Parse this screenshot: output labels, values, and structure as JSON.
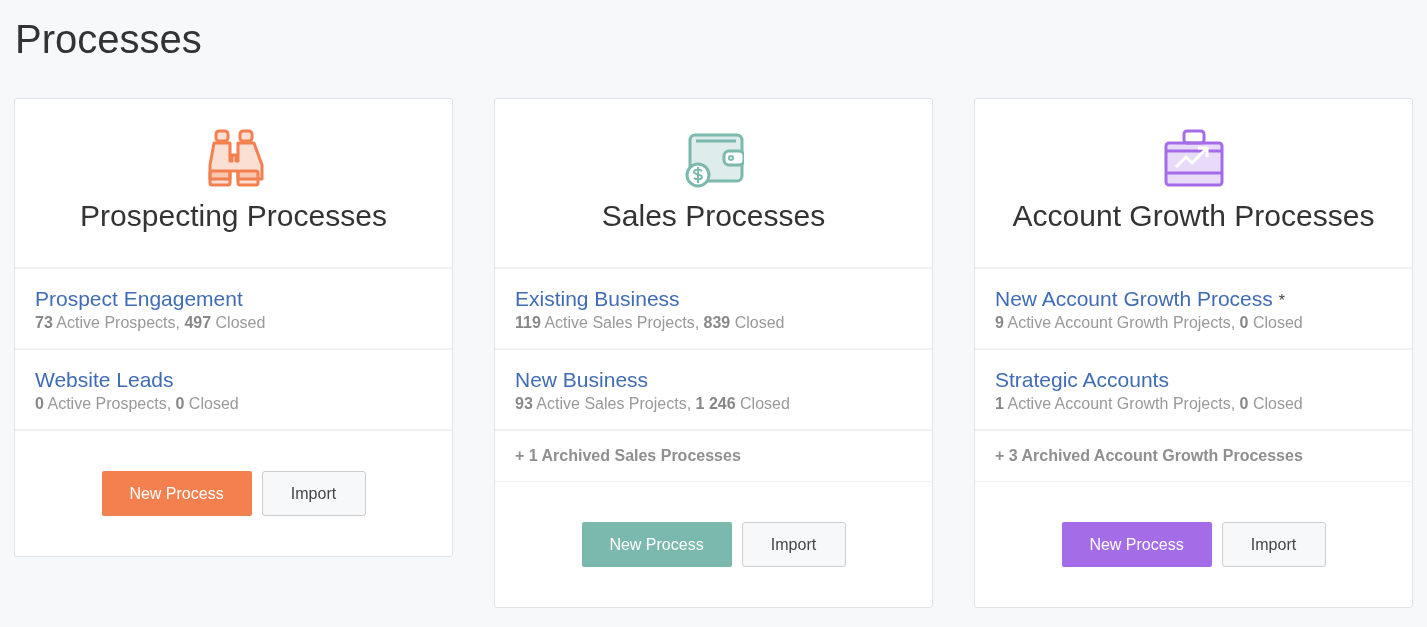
{
  "page_title": "Processes",
  "cards": [
    {
      "kind": "binoculars",
      "color": "#f4804f",
      "title": "Prospecting Processes",
      "processes": [
        {
          "name": "Prospect Engagement",
          "stats": "**73** Active Prospects, **497** Closed"
        },
        {
          "name": "Website Leads",
          "stats": "**0** Active Prospects, **0** Closed"
        }
      ],
      "primary_button": "New Process",
      "secondary_button": "Import"
    },
    {
      "kind": "wallet",
      "color": "#7bb8ae",
      "title": "Sales Processes",
      "processes": [
        {
          "name": "Existing Business",
          "stats": "**119** Active Sales Projects, **839** Closed"
        },
        {
          "name": "New Business",
          "stats": "**93** Active Sales Projects, **1 246** Closed"
        }
      ],
      "archived": "+ 1 Archived Sales Processes",
      "primary_button": "New Process",
      "secondary_button": "Import"
    },
    {
      "kind": "briefcase",
      "color": "#a56ce8",
      "title": "Account Growth Processes",
      "processes": [
        {
          "name": "New Account Growth Process",
          "marker": "*",
          "stats": "**9** Active Account Growth Projects, **0** Closed"
        },
        {
          "name": "Strategic Accounts",
          "stats": "**1** Active Account Growth Projects, **0** Closed"
        }
      ],
      "archived": "+ 3 Archived Account Growth Processes",
      "primary_button": "New Process",
      "secondary_button": "Import"
    }
  ]
}
